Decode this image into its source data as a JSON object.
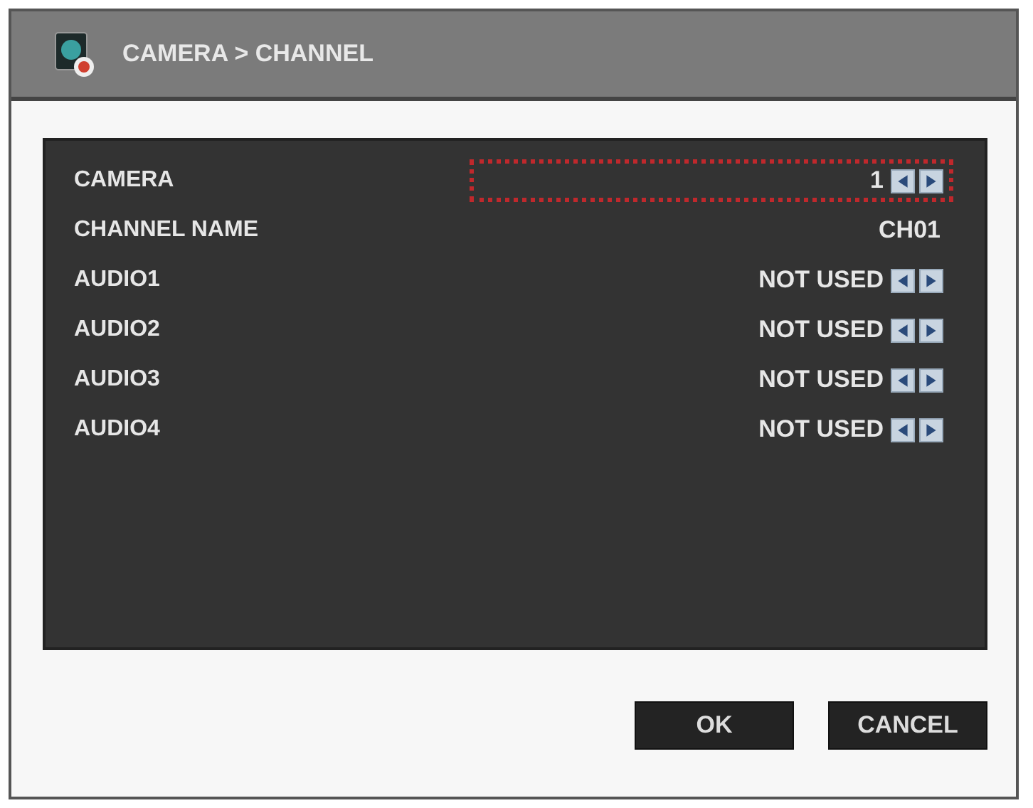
{
  "window": {
    "title": "CAMERA > CHANNEL"
  },
  "rows": [
    {
      "label": "CAMERA",
      "value": "1",
      "kind": "spinner",
      "selected": true
    },
    {
      "label": "CHANNEL NAME",
      "value": "CH01",
      "kind": "text",
      "selected": false
    },
    {
      "label": "AUDIO1",
      "value": "NOT USED",
      "kind": "spinner",
      "selected": false
    },
    {
      "label": "AUDIO2",
      "value": "NOT USED",
      "kind": "spinner",
      "selected": false
    },
    {
      "label": "AUDIO3",
      "value": "NOT USED",
      "kind": "spinner",
      "selected": false
    },
    {
      "label": "AUDIO4",
      "value": "NOT USED",
      "kind": "spinner",
      "selected": false
    }
  ],
  "buttons": [
    "OK",
    "CANCEL"
  ]
}
